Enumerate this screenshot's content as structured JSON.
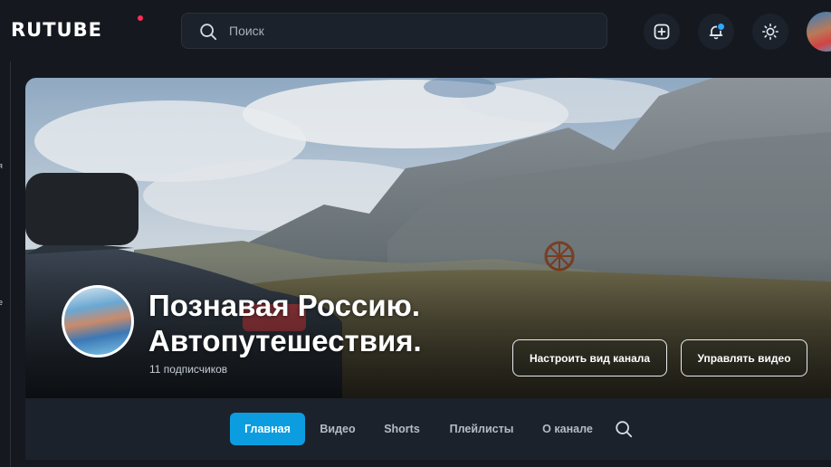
{
  "header": {
    "logo": "RUTUBE",
    "search": {
      "placeholder": "Поиск"
    },
    "icons": [
      "upload-icon",
      "bell-icon",
      "sun-icon"
    ],
    "notification_color": "#2ea7ff"
  },
  "sidebar": {
    "fragments": [
      "я",
      "е"
    ]
  },
  "channel": {
    "title_line1": "Познавая Россию.",
    "title_line2": "Автопутешествия.",
    "subscribers": "11 подписчиков",
    "customize_label": "Настроить вид канала",
    "manage_label": "Управлять видео"
  },
  "tabs": [
    {
      "label": "Главная",
      "active": true
    },
    {
      "label": "Видео",
      "active": false
    },
    {
      "label": "Shorts",
      "active": false
    },
    {
      "label": "Плейлисты",
      "active": false
    },
    {
      "label": "О канале",
      "active": false
    }
  ],
  "colors": {
    "accent": "#0c9de0",
    "background": "#15191f",
    "logo_dot": "#ff2d55"
  }
}
